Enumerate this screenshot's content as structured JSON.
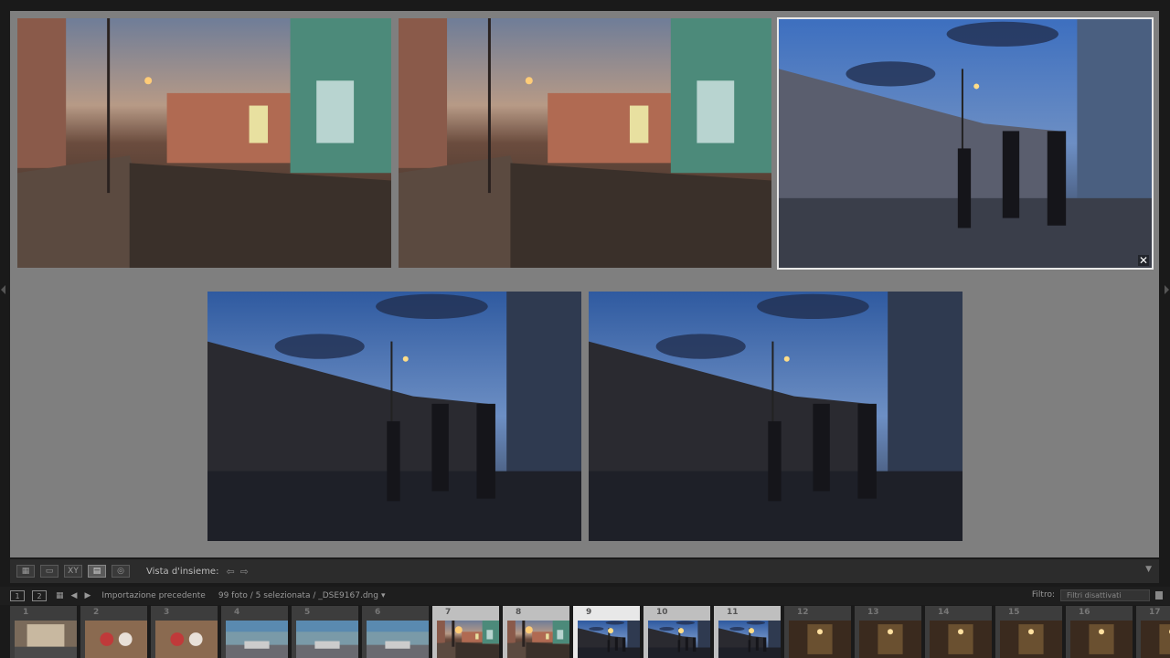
{
  "toolbar": {
    "view_label": "Vista d'insieme:",
    "view_buttons": [
      {
        "name": "grid-view-button",
        "glyph": "▦"
      },
      {
        "name": "loupe-view-button",
        "glyph": "▭"
      },
      {
        "name": "compare-view-button",
        "glyph": "XY"
      },
      {
        "name": "survey-view-button",
        "glyph": "▤"
      },
      {
        "name": "people-view-button",
        "glyph": "◎"
      }
    ]
  },
  "filmstrip_bar": {
    "page1": "1",
    "page2": "2",
    "source": "Importazione precedente",
    "status": "99 foto / 5 selezionata / _DSE9167.dng",
    "filter_label": "Filtro:",
    "filter_value": "Filtri disattivati"
  },
  "filmstrip": {
    "cells": [
      {
        "num": "1",
        "state": "normal",
        "scene": "lobby"
      },
      {
        "num": "2",
        "state": "normal",
        "scene": "dolls"
      },
      {
        "num": "3",
        "state": "normal",
        "scene": "dolls"
      },
      {
        "num": "4",
        "state": "normal",
        "scene": "car"
      },
      {
        "num": "5",
        "state": "normal",
        "scene": "car"
      },
      {
        "num": "6",
        "state": "normal",
        "scene": "car"
      },
      {
        "num": "7",
        "state": "selected",
        "scene": "dusk"
      },
      {
        "num": "8",
        "state": "selected",
        "scene": "dusk"
      },
      {
        "num": "9",
        "state": "active",
        "scene": "blue"
      },
      {
        "num": "10",
        "state": "selected",
        "scene": "blue"
      },
      {
        "num": "11",
        "state": "selected",
        "scene": "blue"
      },
      {
        "num": "12",
        "state": "normal",
        "scene": "interior"
      },
      {
        "num": "13",
        "state": "normal",
        "scene": "interior"
      },
      {
        "num": "14",
        "state": "normal",
        "scene": "interior"
      },
      {
        "num": "15",
        "state": "normal",
        "scene": "interior"
      },
      {
        "num": "16",
        "state": "normal",
        "scene": "interior"
      },
      {
        "num": "17",
        "state": "normal",
        "scene": "interior"
      }
    ]
  },
  "survey_photos": [
    {
      "name": "survey-photo-1",
      "scene": "dusk",
      "selected": false
    },
    {
      "name": "survey-photo-2",
      "scene": "dusk",
      "selected": false
    },
    {
      "name": "survey-photo-3",
      "scene": "bluebright",
      "selected": true
    },
    {
      "name": "survey-photo-4",
      "scene": "blue",
      "selected": false
    },
    {
      "name": "survey-photo-5",
      "scene": "blue",
      "selected": false
    }
  ],
  "colors": {
    "survey_bg": "#7f7f7f",
    "selection_outline": "#e8e8e8"
  }
}
